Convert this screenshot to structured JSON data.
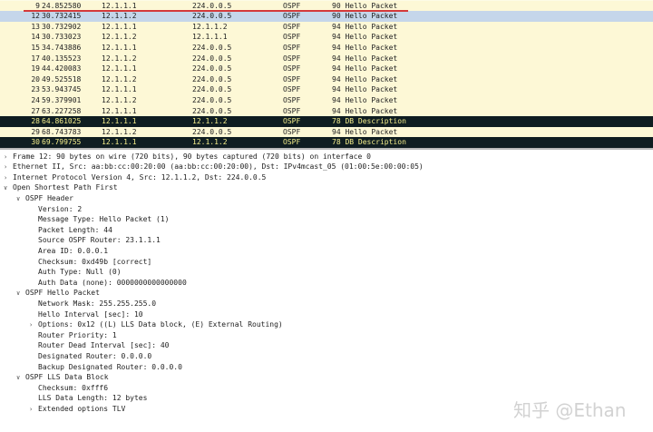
{
  "packets": [
    {
      "no": "9",
      "time": "24.852580",
      "src": "12.1.1.1",
      "dst": "224.0.0.5",
      "proto": "OSPF",
      "info": "90 Hello Packet",
      "style": "normal"
    },
    {
      "no": "12",
      "time": "30.732415",
      "src": "12.1.1.2",
      "dst": "224.0.0.5",
      "proto": "OSPF",
      "info": "90 Hello Packet",
      "style": "selected"
    },
    {
      "no": "13",
      "time": "30.732902",
      "src": "12.1.1.1",
      "dst": "12.1.1.2",
      "proto": "OSPF",
      "info": "94 Hello Packet",
      "style": "normal"
    },
    {
      "no": "14",
      "time": "30.733023",
      "src": "12.1.1.2",
      "dst": "12.1.1.1",
      "proto": "OSPF",
      "info": "94 Hello Packet",
      "style": "normal"
    },
    {
      "no": "15",
      "time": "34.743886",
      "src": "12.1.1.1",
      "dst": "224.0.0.5",
      "proto": "OSPF",
      "info": "94 Hello Packet",
      "style": "normal"
    },
    {
      "no": "17",
      "time": "40.135523",
      "src": "12.1.1.2",
      "dst": "224.0.0.5",
      "proto": "OSPF",
      "info": "94 Hello Packet",
      "style": "normal"
    },
    {
      "no": "19",
      "time": "44.420083",
      "src": "12.1.1.1",
      "dst": "224.0.0.5",
      "proto": "OSPF",
      "info": "94 Hello Packet",
      "style": "normal"
    },
    {
      "no": "20",
      "time": "49.525518",
      "src": "12.1.1.2",
      "dst": "224.0.0.5",
      "proto": "OSPF",
      "info": "94 Hello Packet",
      "style": "normal"
    },
    {
      "no": "23",
      "time": "53.943745",
      "src": "12.1.1.1",
      "dst": "224.0.0.5",
      "proto": "OSPF",
      "info": "94 Hello Packet",
      "style": "normal"
    },
    {
      "no": "24",
      "time": "59.379901",
      "src": "12.1.1.2",
      "dst": "224.0.0.5",
      "proto": "OSPF",
      "info": "94 Hello Packet",
      "style": "normal"
    },
    {
      "no": "27",
      "time": "63.227258",
      "src": "12.1.1.1",
      "dst": "224.0.0.5",
      "proto": "OSPF",
      "info": "94 Hello Packet",
      "style": "normal"
    },
    {
      "no": "28",
      "time": "64.861025",
      "src": "12.1.1.1",
      "dst": "12.1.1.2",
      "proto": "OSPF",
      "info": "78 DB Description",
      "style": "dark"
    },
    {
      "no": "29",
      "time": "68.743783",
      "src": "12.1.1.2",
      "dst": "224.0.0.5",
      "proto": "OSPF",
      "info": "94 Hello Packet",
      "style": "normal"
    },
    {
      "no": "30",
      "time": "69.799755",
      "src": "12.1.1.1",
      "dst": "12.1.1.2",
      "proto": "OSPF",
      "info": "78 DB Description",
      "style": "dark"
    }
  ],
  "details": [
    {
      "indent": 0,
      "arrow": ">",
      "text": "Frame 12: 90 bytes on wire (720 bits), 90 bytes captured (720 bits) on interface 0"
    },
    {
      "indent": 0,
      "arrow": ">",
      "text": "Ethernet II, Src: aa:bb:cc:00:20:00 (aa:bb:cc:00:20:00), Dst: IPv4mcast_05 (01:00:5e:00:00:05)"
    },
    {
      "indent": 0,
      "arrow": ">",
      "text": "Internet Protocol Version 4, Src: 12.1.1.2, Dst: 224.0.0.5"
    },
    {
      "indent": 0,
      "arrow": "v",
      "text": "Open Shortest Path First"
    },
    {
      "indent": 1,
      "arrow": "v",
      "text": "OSPF Header"
    },
    {
      "indent": 2,
      "arrow": "",
      "text": "Version: 2"
    },
    {
      "indent": 2,
      "arrow": "",
      "text": "Message Type: Hello Packet (1)"
    },
    {
      "indent": 2,
      "arrow": "",
      "text": "Packet Length: 44"
    },
    {
      "indent": 2,
      "arrow": "",
      "text": "Source OSPF Router: 23.1.1.1"
    },
    {
      "indent": 2,
      "arrow": "",
      "text": "Area ID: 0.0.0.1"
    },
    {
      "indent": 2,
      "arrow": "",
      "text": "Checksum: 0xd49b [correct]"
    },
    {
      "indent": 2,
      "arrow": "",
      "text": "Auth Type: Null (0)"
    },
    {
      "indent": 2,
      "arrow": "",
      "text": "Auth Data (none): 0000000000000000"
    },
    {
      "indent": 1,
      "arrow": "v",
      "text": "OSPF Hello Packet"
    },
    {
      "indent": 2,
      "arrow": "",
      "text": "Network Mask: 255.255.255.0"
    },
    {
      "indent": 2,
      "arrow": "",
      "text": "Hello Interval [sec]: 10"
    },
    {
      "indent": 2,
      "arrow": ">",
      "text": "Options: 0x12 ((L) LLS Data block, (E) External Routing)"
    },
    {
      "indent": 2,
      "arrow": "",
      "text": "Router Priority: 1"
    },
    {
      "indent": 2,
      "arrow": "",
      "text": "Router Dead Interval [sec]: 40"
    },
    {
      "indent": 2,
      "arrow": "",
      "text": "Designated Router: 0.0.0.0"
    },
    {
      "indent": 2,
      "arrow": "",
      "text": "Backup Designated Router: 0.0.0.0"
    },
    {
      "indent": 1,
      "arrow": "v",
      "text": "OSPF LLS Data Block"
    },
    {
      "indent": 2,
      "arrow": "",
      "text": "Checksum: 0xfff6"
    },
    {
      "indent": 2,
      "arrow": "",
      "text": "LLS Data Length: 12 bytes"
    },
    {
      "indent": 2,
      "arrow": ">",
      "text": "Extended options TLV"
    }
  ],
  "watermark": "知乎 @Ethan",
  "colors": {
    "annotation": "#d43a3a",
    "dark_row": "#0f1d21",
    "dark_row_text": "#f4ee8c",
    "selected_row": "#c5d6ea"
  }
}
